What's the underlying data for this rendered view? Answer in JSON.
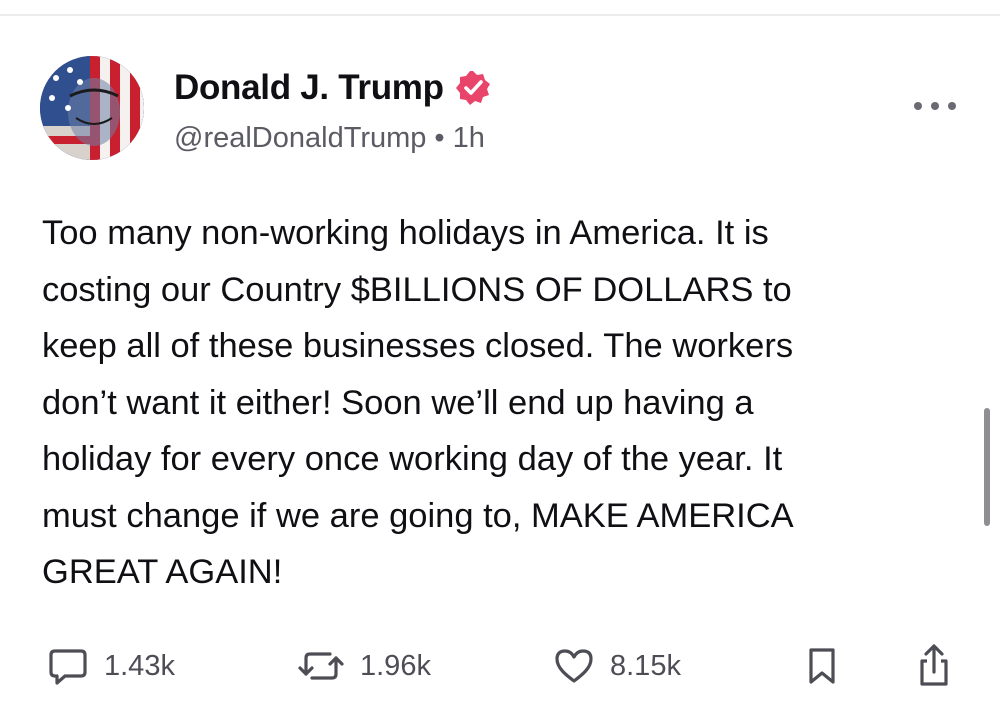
{
  "post": {
    "author": {
      "name": "Donald J. Trump",
      "handle": "@realDonaldTrump",
      "verified": true,
      "verified_color": "#e9456b"
    },
    "separator": "•",
    "time": "1h",
    "text": "Too many non-working holidays in America. It is\ncosting our Country $BILLIONS OF DOLLARS to\nkeep all of these businesses closed. The workers\ndon’t want it either! Soon we’ll end up having a\nholiday for every once working day of the year. It\nmust change if we are going to, MAKE AMERICA\nGREAT AGAIN!",
    "stats": {
      "replies": "1.43k",
      "reposts": "1.96k",
      "likes": "8.15k"
    }
  },
  "icons": {
    "more": "more-horizontal-icon",
    "reply": "speech-bubble-icon",
    "repost": "repost-arrows-icon",
    "like": "heart-icon",
    "bookmark": "bookmark-icon",
    "share": "share-icon",
    "verified": "verified-badge-icon"
  },
  "colors": {
    "text": "#0f0f14",
    "secondary": "#5b5b64",
    "icon": "#4d4d55",
    "verified": "#e9456b"
  }
}
